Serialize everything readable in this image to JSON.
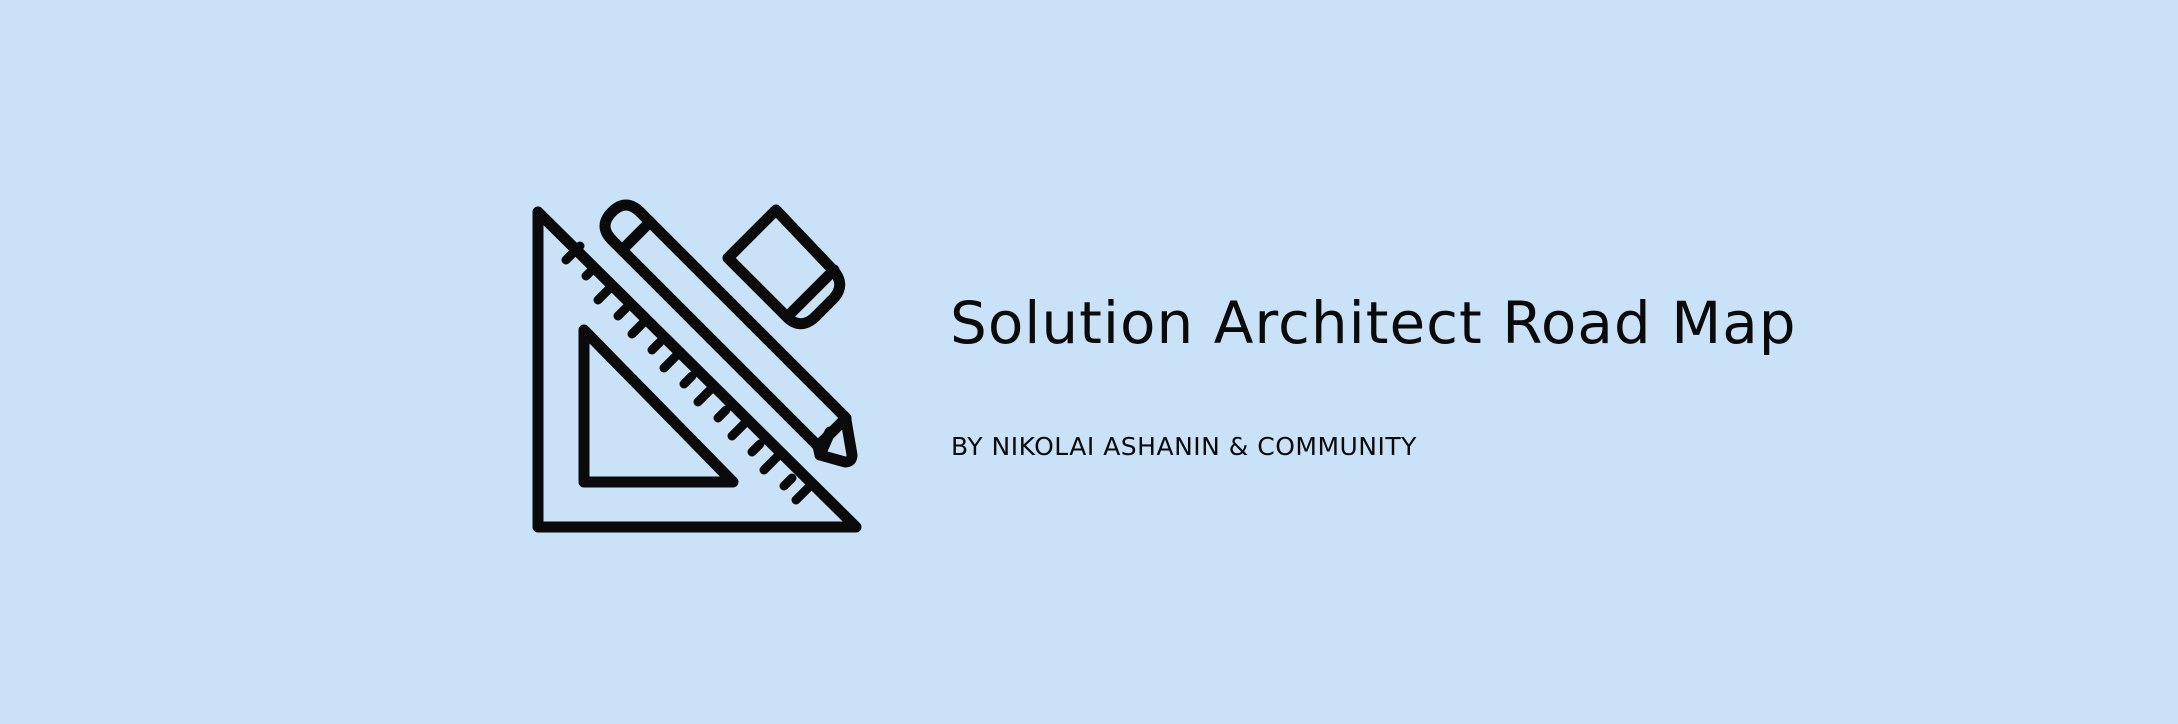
{
  "banner": {
    "title": "Solution Architect Road Map",
    "subtitle": "BY NIKOLAI ASHANIN & COMMUNITY",
    "logo_icon": "drafting-tools-icon"
  },
  "colors": {
    "background": "#cae2f8",
    "foreground": "#0a0a0a"
  }
}
